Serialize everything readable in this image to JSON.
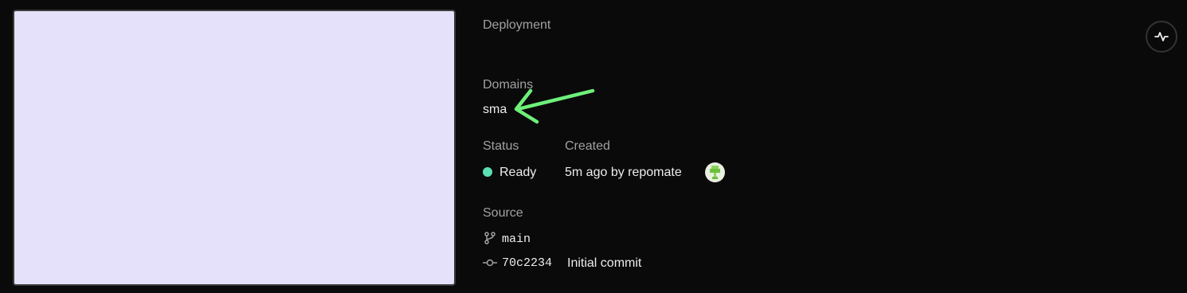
{
  "deployment": {
    "heading": "Deployment",
    "domains_label": "Domains",
    "domain_value": "sma",
    "status_label": "Status",
    "status_value": "Ready",
    "status_color": "#5be0b3",
    "created_label": "Created",
    "created_value": "5m ago by repomate",
    "source_label": "Source",
    "branch": "main",
    "commit_hash": "70c2234",
    "commit_message": "Initial commit"
  },
  "colors": {
    "preview_bg": "#e6e1fa",
    "annotation_arrow": "#6ef07a"
  },
  "icons": {
    "activity": "activity-icon",
    "branch": "git-branch-icon",
    "commit": "git-commit-icon"
  }
}
